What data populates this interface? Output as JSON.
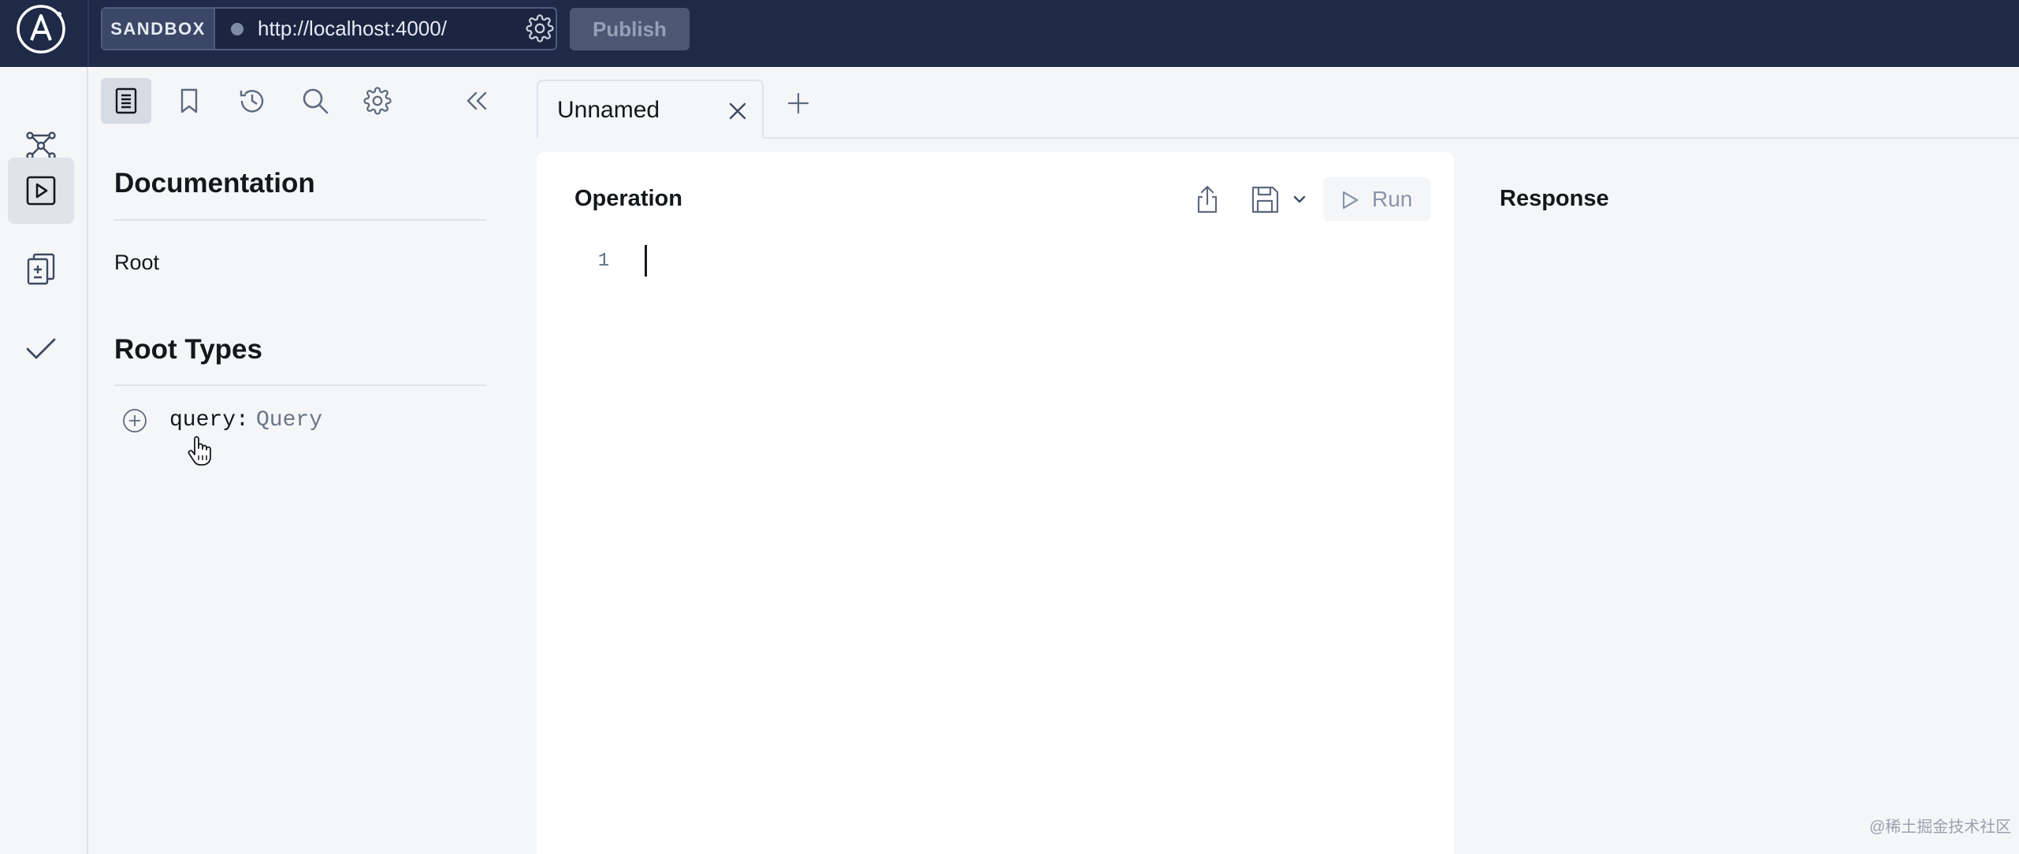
{
  "colors": {
    "topbar_bg": "#1e2a47",
    "panel_bg": "#f4f6f8",
    "editor_bg": "#ffffff",
    "text_primary": "#14171c",
    "text_muted": "#6b7588"
  },
  "topbar": {
    "logo_icon": "apollo-logo-icon",
    "sandbox_label": "SANDBOX",
    "url": "http://localhost:4000/",
    "url_settings_icon": "gear-icon",
    "publish_label": "Publish"
  },
  "rail": {
    "items": [
      {
        "icon": "graph-icon",
        "active": false
      },
      {
        "icon": "explorer-play-icon",
        "active": true
      },
      {
        "icon": "schema-diff-icon",
        "active": false
      },
      {
        "icon": "checks-icon",
        "active": false
      }
    ]
  },
  "left_panel": {
    "toolbar": [
      {
        "icon": "documentation-icon",
        "active": true
      },
      {
        "icon": "bookmark-icon",
        "active": false
      },
      {
        "icon": "history-icon",
        "active": false
      },
      {
        "icon": "search-icon",
        "active": false
      },
      {
        "icon": "gear-icon",
        "active": false
      },
      {
        "icon": "collapse-icon",
        "active": false
      }
    ],
    "documentation_title": "Documentation",
    "root_link": "Root",
    "root_types_title": "Root Types",
    "fields": [
      {
        "name": "query:",
        "type": "Query"
      }
    ]
  },
  "tabs": [
    {
      "label": "Unnamed",
      "active": true
    }
  ],
  "operation": {
    "title": "Operation",
    "run_label": "Run",
    "lines": [
      "1"
    ]
  },
  "response": {
    "title": "Response"
  },
  "watermark": "@稀土掘金技术社区"
}
